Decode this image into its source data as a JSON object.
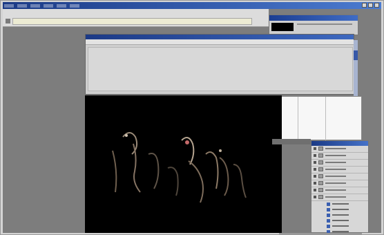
{
  "app": {
    "menu_items": 6,
    "title_buttons": 3
  },
  "toolbar": {
    "icon": "document-icon"
  },
  "top_right_panel": {
    "has_black_preview": true
  },
  "dialog": {
    "body": "empty-panel"
  },
  "canvas": {
    "background": "#000000",
    "content": "dim-crowd-image"
  },
  "layers_panel": {
    "rows": 8,
    "sub_rows": 6
  }
}
